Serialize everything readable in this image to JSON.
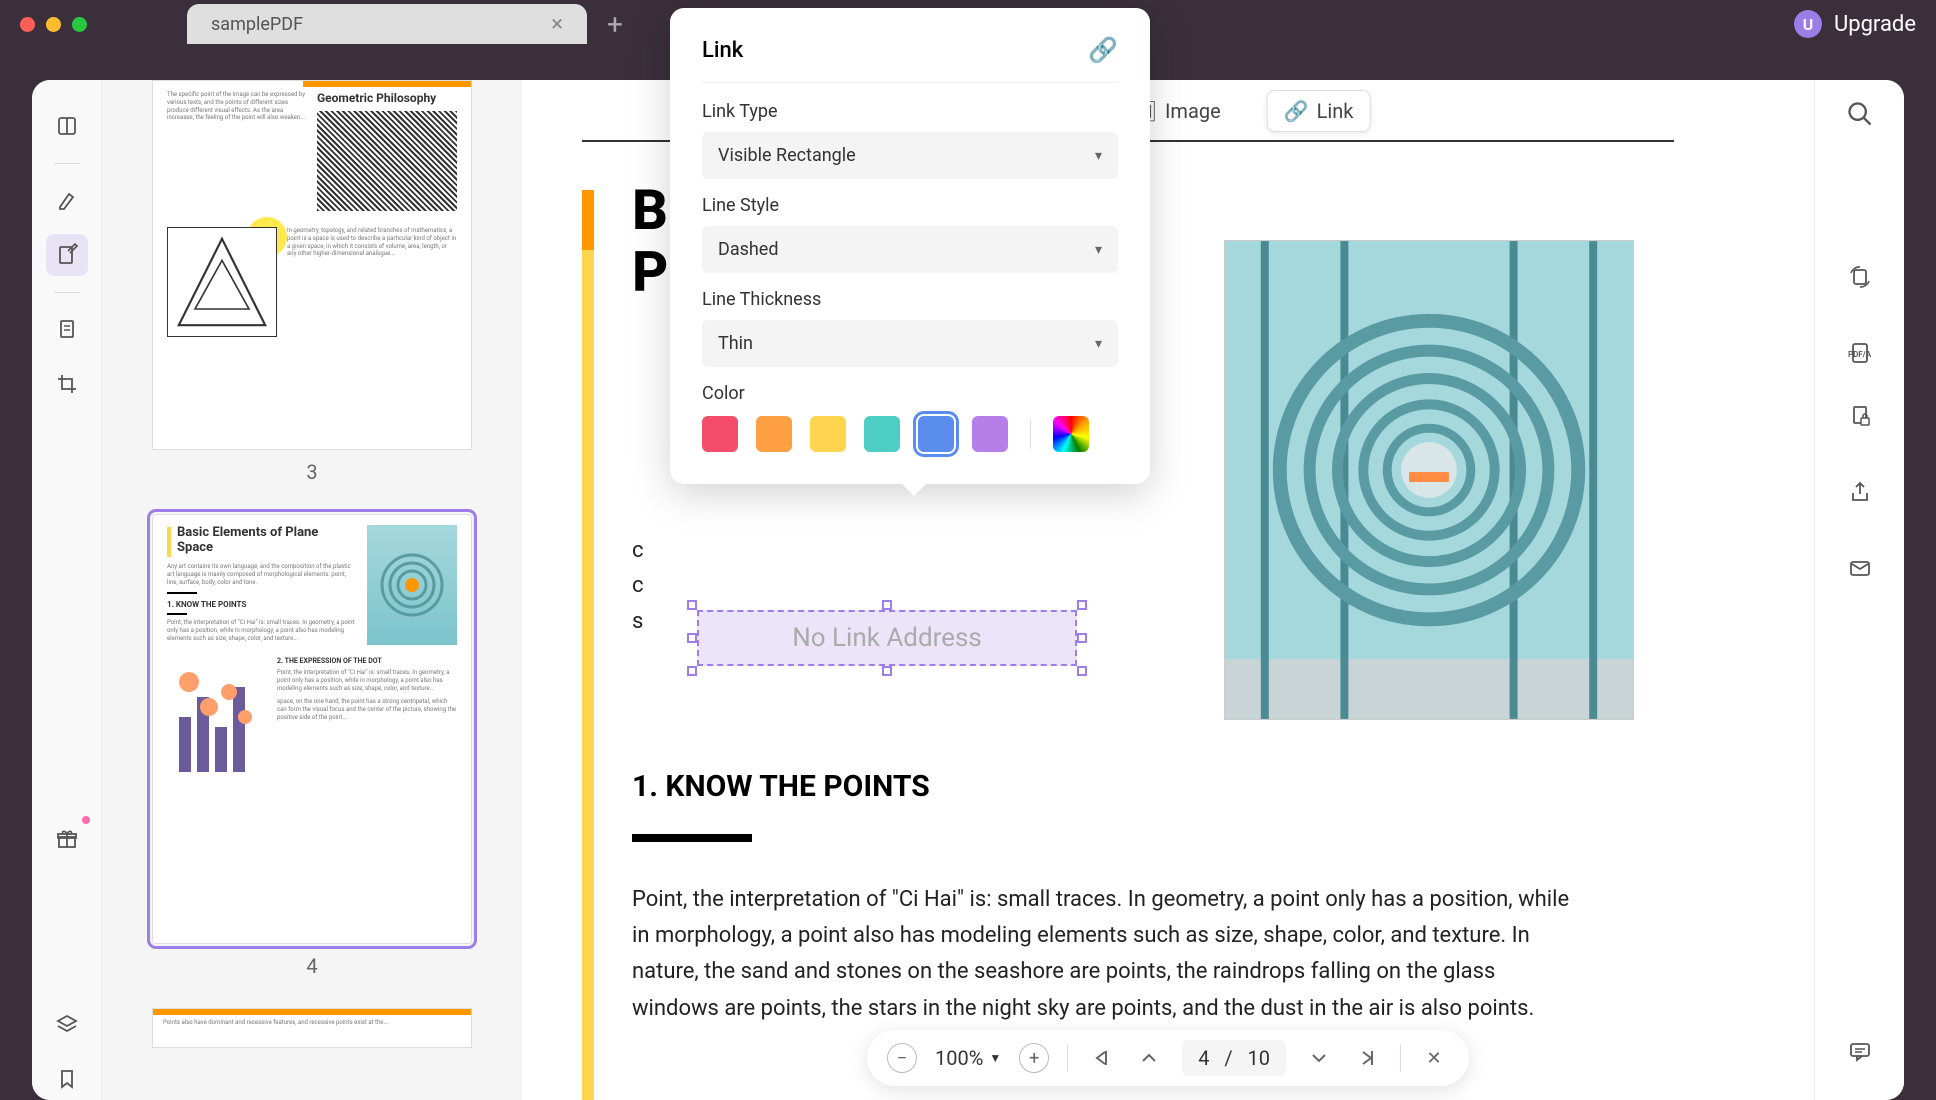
{
  "titlebar": {
    "tab_name": "samplePDF",
    "upgrade_label": "Upgrade",
    "avatar_letter": "U"
  },
  "top_toolbar": {
    "image_label": "Image",
    "link_label": "Link"
  },
  "popup": {
    "title": "Link",
    "link_type_label": "Link Type",
    "link_type_value": "Visible Rectangle",
    "line_style_label": "Line Style",
    "line_style_value": "Dashed",
    "line_thickness_label": "Line Thickness",
    "line_thickness_value": "Thin",
    "color_label": "Color",
    "colors": [
      "#f44d6a",
      "#ff9f43",
      "#ffd54f",
      "#4ecdc4",
      "#5b8def",
      "#b57ee8"
    ],
    "selected_color_index": 4
  },
  "link_annotation": {
    "placeholder": "No Link Address"
  },
  "thumbnails": {
    "page3_label": "3",
    "page3_title": "Geometric Philosophy",
    "page4_label": "4",
    "page4_title": "Basic Elements of Plane Space",
    "page4_sub1": "1. KNOW THE POINTS",
    "page4_sub2": "2. THE EXPRESSION OF THE DOT"
  },
  "document": {
    "heading_line1": "B",
    "heading_line2": "P",
    "section1_title": "1. KNOW THE POINTS",
    "body1": "Point, the interpretation of \"Ci Hai\" is: small traces. In geometry, a point only has a position, while in morphology, a point also has modeling elements such as size, shape, color, and texture. In nature, the sand and stones on the seashore are points, the raindrops falling on the glass windows are points, the stars in the night sky are points, and the dust in the air is also points."
  },
  "bottom_bar": {
    "zoom": "100%",
    "current_page": "4",
    "page_sep": "/",
    "total_pages": "10"
  }
}
